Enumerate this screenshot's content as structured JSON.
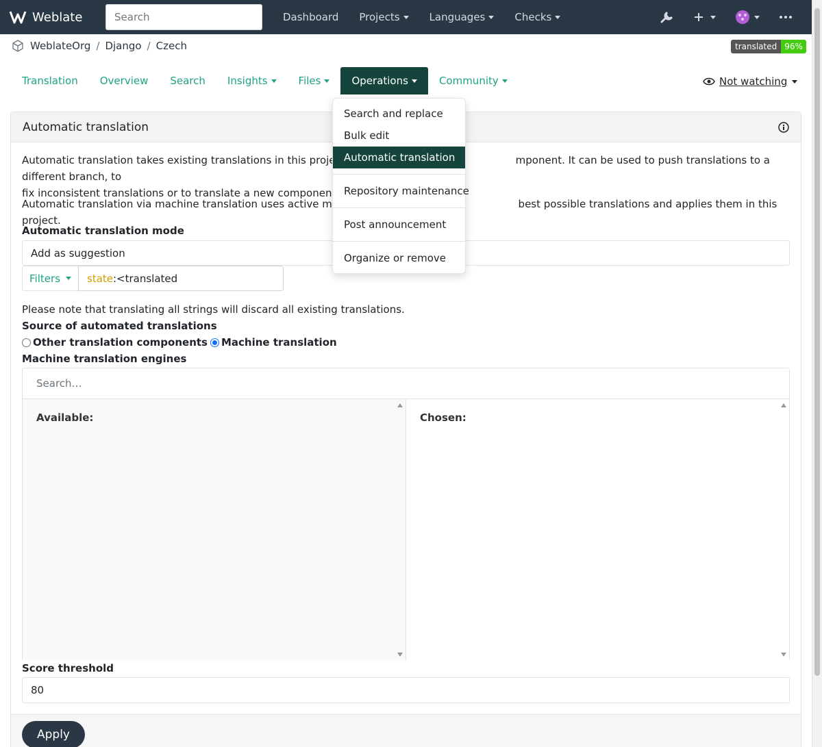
{
  "navbar": {
    "brand": "Weblate",
    "search_placeholder": "Search",
    "links": [
      "Dashboard",
      "Projects",
      "Languages",
      "Checks"
    ]
  },
  "breadcrumb": [
    "WeblateOrg",
    "Django",
    "Czech"
  ],
  "badge": {
    "label": "translated",
    "value": "96%"
  },
  "tabs": [
    "Translation",
    "Overview",
    "Search",
    "Insights",
    "Files",
    "Operations",
    "Community"
  ],
  "watch": "Not watching",
  "card": {
    "title": "Automatic translation",
    "p1a": "Automatic translation takes existing translations in this project and a",
    "p1b": "mponent. It can be used to push translations to a different branch, to",
    "p1c": "fix inconsistent translations or to translate a new component using t",
    "p2a": "Automatic translation via machine translation uses active machine tr",
    "p2b": "best possible translations and applies them in this project."
  },
  "form": {
    "mode_label": "Automatic translation mode",
    "mode_value": "Add as suggestion",
    "filters_label": "Filters",
    "filter_key": "state",
    "filter_rest": ":<translated",
    "note": "Please note that translating all strings will discard all existing translations.",
    "source_label": "Source of automated translations",
    "source_opt1": "Other translation components",
    "source_opt2": "Machine translation",
    "engines_label": "Machine translation engines",
    "engines_search": "Search…",
    "available": "Available:",
    "chosen": "Chosen:",
    "score_label": "Score threshold",
    "score_value": "80",
    "apply": "Apply"
  },
  "dropdown": {
    "items": [
      "Search and replace",
      "Bulk edit",
      "Automatic translation",
      "Repository maintenance",
      "Post announcement",
      "Organize or remove"
    ]
  },
  "colors": {
    "navbar": "#2a3744",
    "accent": "#1fa385",
    "active": "#14443b"
  }
}
